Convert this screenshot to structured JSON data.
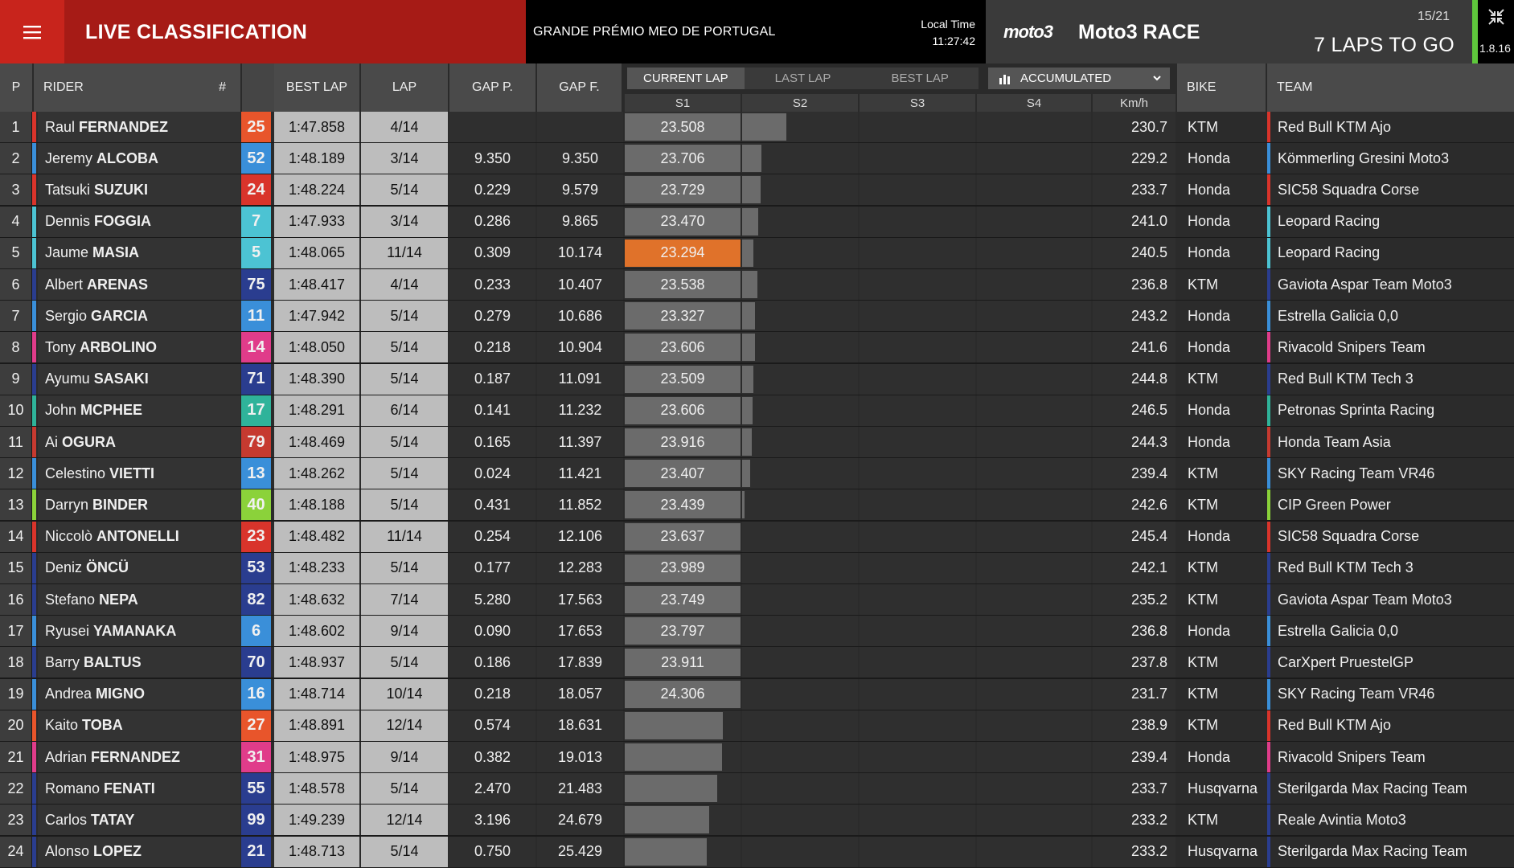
{
  "header": {
    "live_title": "LIVE CLASSIFICATION",
    "gp_name": "GRANDE PRÉMIO MEO DE PORTUGAL",
    "local_time_label": "Local Time",
    "local_time": "11:27:42",
    "brand": "moto3",
    "race_name": "Moto3 RACE",
    "race_count": "15/21",
    "laps_to_go": "7 LAPS TO GO",
    "version": "1.8.16"
  },
  "columns": {
    "pos": "P",
    "rider": "RIDER",
    "num": "#",
    "best_lap": "BEST LAP",
    "lap": "LAP",
    "gap_p": "GAP P.",
    "gap_f": "GAP F.",
    "bike": "BIKE",
    "team": "TEAM",
    "s1": "S1",
    "s2": "S2",
    "s3": "S3",
    "s4": "S4",
    "kmh": "Km/h"
  },
  "lap_tabs": [
    "CURRENT LAP",
    "LAST LAP",
    "BEST LAP"
  ],
  "active_tab": 0,
  "accumulated_label": "ACCUMULATED",
  "colors": {
    "orange_highlight": "#e0722a"
  },
  "rows": [
    {
      "p": "1",
      "first": "Raul",
      "last": "FERNANDEZ",
      "num": "25",
      "num_bg": "#e8552b",
      "strip": "#d9342b",
      "best": "1:47.858",
      "lap": "4/14",
      "gapp": "",
      "gapf": "",
      "s1": "23.508",
      "s1_fill": 1,
      "s2_fill": 0.38,
      "kmh": "230.7",
      "bike": "KTM",
      "team": "Red Bull KTM Ajo",
      "team_color": "#d9342b"
    },
    {
      "p": "2",
      "first": "Jeremy",
      "last": "ALCOBA",
      "num": "52",
      "num_bg": "#3a8fd9",
      "strip": "#3a8fd9",
      "best": "1:48.189",
      "lap": "3/14",
      "gapp": "9.350",
      "gapf": "9.350",
      "s1": "23.706",
      "s1_fill": 1,
      "s2_fill": 0.17,
      "kmh": "229.2",
      "bike": "Honda",
      "team": "Kömmerling Gresini Moto3",
      "team_color": "#3a8fd9"
    },
    {
      "p": "3",
      "first": "Tatsuki",
      "last": "SUZUKI",
      "num": "24",
      "num_bg": "#d9342b",
      "strip": "#d9342b",
      "best": "1:48.224",
      "lap": "5/14",
      "gapp": "0.229",
      "gapf": "9.579",
      "s1": "23.729",
      "s1_fill": 1,
      "s2_fill": 0.16,
      "kmh": "233.7",
      "bike": "Honda",
      "team": "SIC58 Squadra Corse",
      "team_color": "#d9342b"
    },
    {
      "p": "4",
      "first": "Dennis",
      "last": "FOGGIA",
      "num": "7",
      "num_bg": "#4cc3d3",
      "strip": "#4cc3d3",
      "best": "1:47.933",
      "lap": "3/14",
      "gapp": "0.286",
      "gapf": "9.865",
      "s1": "23.470",
      "s1_fill": 1,
      "s2_fill": 0.14,
      "kmh": "241.0",
      "bike": "Honda",
      "team": "Leopard Racing",
      "team_color": "#4cc3d3"
    },
    {
      "p": "5",
      "first": "Jaume",
      "last": "MASIA",
      "num": "5",
      "num_bg": "#4cc3d3",
      "strip": "#4cc3d3",
      "best": "1:48.065",
      "lap": "11/14",
      "gapp": "0.309",
      "gapf": "10.174",
      "s1": "23.294",
      "s1_fill": 1,
      "s1_orange": true,
      "s2_fill": 0.1,
      "kmh": "240.5",
      "bike": "Honda",
      "team": "Leopard Racing",
      "team_color": "#4cc3d3"
    },
    {
      "p": "6",
      "first": "Albert",
      "last": "ARENAS",
      "num": "75",
      "num_bg": "#2a3d8f",
      "strip": "#2a3d8f",
      "best": "1:48.417",
      "lap": "4/14",
      "gapp": "0.233",
      "gapf": "10.407",
      "s1": "23.538",
      "s1_fill": 1,
      "s2_fill": 0.13,
      "kmh": "236.8",
      "bike": "KTM",
      "team": "Gaviota Aspar Team Moto3",
      "team_color": "#2a3d8f"
    },
    {
      "p": "7",
      "first": "Sergio",
      "last": "GARCIA",
      "num": "11",
      "num_bg": "#3a8fd9",
      "strip": "#3a8fd9",
      "best": "1:47.942",
      "lap": "5/14",
      "gapp": "0.279",
      "gapf": "10.686",
      "s1": "23.327",
      "s1_fill": 1,
      "s2_fill": 0.11,
      "kmh": "243.2",
      "bike": "Honda",
      "team": "Estrella Galicia 0,0",
      "team_color": "#3a8fd9"
    },
    {
      "p": "8",
      "first": "Tony",
      "last": "ARBOLINO",
      "num": "14",
      "num_bg": "#e03c8a",
      "strip": "#e03c8a",
      "best": "1:48.050",
      "lap": "5/14",
      "gapp": "0.218",
      "gapf": "10.904",
      "s1": "23.606",
      "s1_fill": 1,
      "s2_fill": 0.11,
      "kmh": "241.6",
      "bike": "Honda",
      "team": "Rivacold Snipers Team",
      "team_color": "#e03c8a"
    },
    {
      "p": "9",
      "first": "Ayumu",
      "last": "SASAKI",
      "num": "71",
      "num_bg": "#2a3d8f",
      "strip": "#2a3d8f",
      "best": "1:48.390",
      "lap": "5/14",
      "gapp": "0.187",
      "gapf": "11.091",
      "s1": "23.509",
      "s1_fill": 1,
      "s2_fill": 0.1,
      "kmh": "244.8",
      "bike": "KTM",
      "team": "Red Bull KTM Tech 3",
      "team_color": "#2a3d8f"
    },
    {
      "p": "10",
      "first": "John",
      "last": "MCPHEE",
      "num": "17",
      "num_bg": "#2fb39a",
      "strip": "#2fb39a",
      "best": "1:48.291",
      "lap": "6/14",
      "gapp": "0.141",
      "gapf": "11.232",
      "s1": "23.606",
      "s1_fill": 1,
      "s2_fill": 0.09,
      "kmh": "246.5",
      "bike": "Honda",
      "team": "Petronas Sprinta Racing",
      "team_color": "#2fb39a"
    },
    {
      "p": "11",
      "first": "Ai",
      "last": "OGURA",
      "num": "79",
      "num_bg": "#c63a30",
      "strip": "#c63a30",
      "best": "1:48.469",
      "lap": "5/14",
      "gapp": "0.165",
      "gapf": "11.397",
      "s1": "23.916",
      "s1_fill": 1,
      "s2_fill": 0.08,
      "kmh": "244.3",
      "bike": "Honda",
      "team": "Honda Team Asia",
      "team_color": "#c63a30"
    },
    {
      "p": "12",
      "first": "Celestino",
      "last": "VIETTI",
      "num": "13",
      "num_bg": "#3a8fd9",
      "strip": "#3a8fd9",
      "best": "1:48.262",
      "lap": "5/14",
      "gapp": "0.024",
      "gapf": "11.421",
      "s1": "23.407",
      "s1_fill": 1,
      "s2_fill": 0.07,
      "kmh": "239.4",
      "bike": "KTM",
      "team": "SKY Racing Team VR46",
      "team_color": "#3a8fd9"
    },
    {
      "p": "13",
      "first": "Darryn",
      "last": "BINDER",
      "num": "40",
      "num_bg": "#8bd23a",
      "strip": "#8bd23a",
      "best": "1:48.188",
      "lap": "5/14",
      "gapp": "0.431",
      "gapf": "11.852",
      "s1": "23.439",
      "s1_fill": 1,
      "s2_fill": 0.02,
      "kmh": "242.6",
      "bike": "KTM",
      "team": "CIP Green Power",
      "team_color": "#8bd23a"
    },
    {
      "p": "14",
      "first": "Niccolò",
      "last": "ANTONELLI",
      "num": "23",
      "num_bg": "#d9342b",
      "strip": "#d9342b",
      "best": "1:48.482",
      "lap": "11/14",
      "gapp": "0.254",
      "gapf": "12.106",
      "s1": "23.637",
      "s1_fill": 1,
      "s2_fill": 0,
      "kmh": "245.4",
      "bike": "Honda",
      "team": "SIC58 Squadra Corse",
      "team_color": "#d9342b"
    },
    {
      "p": "15",
      "first": "Deniz",
      "last": "ÖNCÜ",
      "num": "53",
      "num_bg": "#2a3d8f",
      "strip": "#2a3d8f",
      "best": "1:48.233",
      "lap": "5/14",
      "gapp": "0.177",
      "gapf": "12.283",
      "s1": "23.989",
      "s1_fill": 1,
      "s2_fill": 0,
      "kmh": "242.1",
      "bike": "KTM",
      "team": "Red Bull KTM Tech 3",
      "team_color": "#2a3d8f"
    },
    {
      "p": "16",
      "first": "Stefano",
      "last": "NEPA",
      "num": "82",
      "num_bg": "#2a3d8f",
      "strip": "#2a3d8f",
      "best": "1:48.632",
      "lap": "7/14",
      "gapp": "5.280",
      "gapf": "17.563",
      "s1": "23.749",
      "s1_fill": 1,
      "s2_fill": 0,
      "kmh": "235.2",
      "bike": "KTM",
      "team": "Gaviota Aspar Team Moto3",
      "team_color": "#2a3d8f"
    },
    {
      "p": "17",
      "first": "Ryusei",
      "last": "YAMANAKA",
      "num": "6",
      "num_bg": "#3a8fd9",
      "strip": "#3a8fd9",
      "best": "1:48.602",
      "lap": "9/14",
      "gapp": "0.090",
      "gapf": "17.653",
      "s1": "23.797",
      "s1_fill": 1,
      "s2_fill": 0,
      "kmh": "236.8",
      "bike": "Honda",
      "team": "Estrella Galicia 0,0",
      "team_color": "#3a8fd9"
    },
    {
      "p": "18",
      "first": "Barry",
      "last": "BALTUS",
      "num": "70",
      "num_bg": "#2a3d8f",
      "strip": "#2a3d8f",
      "best": "1:48.937",
      "lap": "5/14",
      "gapp": "0.186",
      "gapf": "17.839",
      "s1": "23.911",
      "s1_fill": 1,
      "s2_fill": 0,
      "kmh": "237.8",
      "bike": "KTM",
      "team": "CarXpert PruestelGP",
      "team_color": "#2a3d8f"
    },
    {
      "p": "19",
      "first": "Andrea",
      "last": "MIGNO",
      "num": "16",
      "num_bg": "#3a8fd9",
      "strip": "#3a8fd9",
      "best": "1:48.714",
      "lap": "10/14",
      "gapp": "0.218",
      "gapf": "18.057",
      "s1": "24.306",
      "s1_fill": 1,
      "s2_fill": 0,
      "kmh": "231.7",
      "bike": "KTM",
      "team": "SKY Racing Team VR46",
      "team_color": "#3a8fd9"
    },
    {
      "p": "20",
      "first": "Kaito",
      "last": "TOBA",
      "num": "27",
      "num_bg": "#e8552b",
      "strip": "#e8552b",
      "best": "1:48.891",
      "lap": "12/14",
      "gapp": "0.574",
      "gapf": "18.631",
      "s1": "",
      "s1_fill": 0.85,
      "s2_fill": 0,
      "kmh": "238.9",
      "bike": "KTM",
      "team": "Red Bull KTM Ajo",
      "team_color": "#d9342b"
    },
    {
      "p": "21",
      "first": "Adrian",
      "last": "FERNANDEZ",
      "num": "31",
      "num_bg": "#e03c8a",
      "strip": "#e03c8a",
      "best": "1:48.975",
      "lap": "9/14",
      "gapp": "0.382",
      "gapf": "19.013",
      "s1": "",
      "s1_fill": 0.84,
      "s2_fill": 0,
      "kmh": "239.4",
      "bike": "Honda",
      "team": "Rivacold Snipers Team",
      "team_color": "#e03c8a"
    },
    {
      "p": "22",
      "first": "Romano",
      "last": "FENATI",
      "num": "55",
      "num_bg": "#2a3d8f",
      "strip": "#2a3d8f",
      "best": "1:48.578",
      "lap": "5/14",
      "gapp": "2.470",
      "gapf": "21.483",
      "s1": "",
      "s1_fill": 0.8,
      "s2_fill": 0,
      "kmh": "233.7",
      "bike": "Husqvarna",
      "team": "Sterilgarda Max Racing Team",
      "team_color": "#2a3d8f"
    },
    {
      "p": "23",
      "first": "Carlos",
      "last": "TATAY",
      "num": "99",
      "num_bg": "#2a3d8f",
      "strip": "#2a3d8f",
      "best": "1:49.239",
      "lap": "12/14",
      "gapp": "3.196",
      "gapf": "24.679",
      "s1": "",
      "s1_fill": 0.73,
      "s2_fill": 0,
      "kmh": "233.2",
      "bike": "KTM",
      "team": "Reale Avintia Moto3",
      "team_color": "#2a3d8f"
    },
    {
      "p": "24",
      "first": "Alonso",
      "last": "LOPEZ",
      "num": "21",
      "num_bg": "#2a3d8f",
      "strip": "#2a3d8f",
      "best": "1:48.713",
      "lap": "5/14",
      "gapp": "0.750",
      "gapf": "25.429",
      "s1": "",
      "s1_fill": 0.71,
      "s2_fill": 0,
      "kmh": "233.2",
      "bike": "Husqvarna",
      "team": "Sterilgarda Max Racing Team",
      "team_color": "#2a3d8f"
    }
  ]
}
